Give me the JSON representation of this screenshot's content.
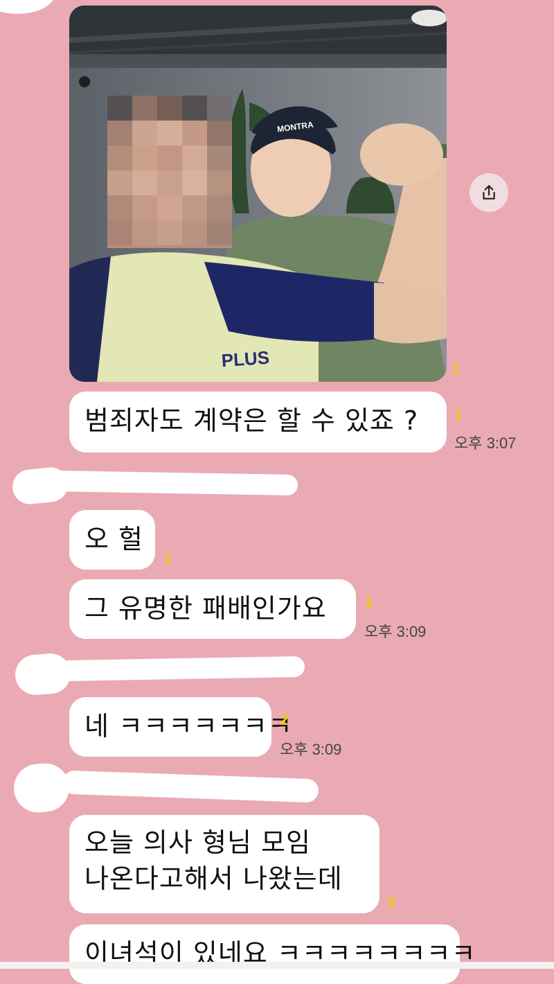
{
  "chat": {
    "messages": [
      {
        "text": "범죄자도 계약은 할 수 있죠 ?",
        "unread": "1",
        "time": "오후 3:07"
      },
      {
        "text": "오 헐",
        "unread": "1"
      },
      {
        "text": "그 유명한 패배인가요",
        "unread": "1",
        "time": "오후 3:09"
      },
      {
        "text": "네 ㅋㅋㅋㅋㅋㅋㅋ",
        "unread": "2",
        "time": "오후 3:09"
      },
      {
        "line1": "오늘 의사 형님 모임",
        "line2": "나온다고해서 나왔는데",
        "unread": "3"
      },
      {
        "text": "이녀석이 있네요 ㅋㅋㅋㅋㅋㅋㅋㅋ"
      }
    ],
    "photo_unread": "1",
    "photo": {
      "cap_text": "MONTRA",
      "shirt_text": "PLUS"
    }
  },
  "icons": {
    "share": "share-icon"
  },
  "colors": {
    "background": "#e9aab3",
    "bubble": "#ffffff",
    "unread": "#f5c518"
  }
}
